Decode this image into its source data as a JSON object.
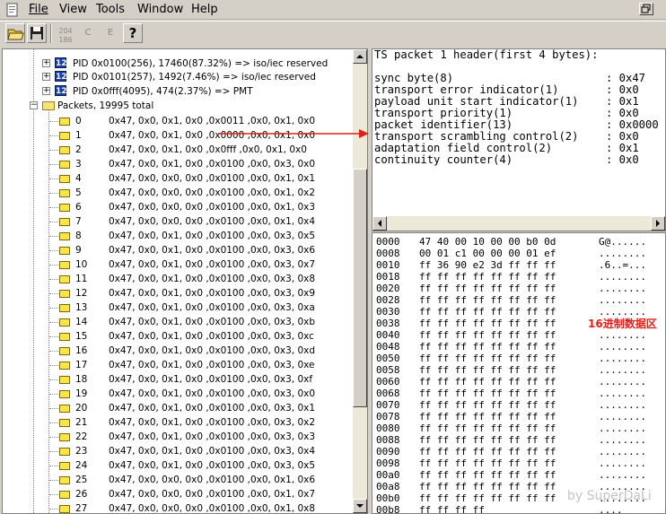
{
  "menu": {
    "items": [
      "File",
      "View",
      "Tools",
      "Window",
      "Help"
    ]
  },
  "toolbar": {
    "buttons": [
      {
        "name": "open-folder-icon"
      },
      {
        "name": "save-icon"
      },
      {
        "name": "hex-toggle",
        "label": "204\n186"
      },
      {
        "name": "c-button",
        "label": "C"
      },
      {
        "name": "e-button",
        "label": "E"
      },
      {
        "name": "help-icon",
        "label": "?"
      }
    ]
  },
  "tree": {
    "pids": [
      {
        "icon": "12",
        "text": "PID 0x0100(256), 17460(87.32%) => iso/iec reserved"
      },
      {
        "icon": "12",
        "text": "PID 0x0101(257), 1492(7.46%) => iso/iec reserved"
      },
      {
        "icon": "12",
        "text": "PID 0x0fff(4095), 474(2.37%) => PMT"
      }
    ],
    "packets_label": "Packets, 19995 total",
    "packets": [
      {
        "n": "0",
        "d": "0x47, 0x0, 0x1, 0x0 ,0x0011 ,0x0, 0x1, 0x0"
      },
      {
        "n": "1",
        "d": "0x47, 0x0, 0x1, 0x0 ,0x0000 ,0x0, 0x1, 0x0"
      },
      {
        "n": "2",
        "d": "0x47, 0x0, 0x1, 0x0 ,0x0fff ,0x0, 0x1, 0x0"
      },
      {
        "n": "3",
        "d": "0x47, 0x0, 0x1, 0x0 ,0x0100 ,0x0, 0x3, 0x0"
      },
      {
        "n": "4",
        "d": "0x47, 0x0, 0x0, 0x0 ,0x0100 ,0x0, 0x1, 0x1"
      },
      {
        "n": "5",
        "d": "0x47, 0x0, 0x0, 0x0 ,0x0100 ,0x0, 0x1, 0x2"
      },
      {
        "n": "6",
        "d": "0x47, 0x0, 0x0, 0x0 ,0x0100 ,0x0, 0x1, 0x3"
      },
      {
        "n": "7",
        "d": "0x47, 0x0, 0x0, 0x0 ,0x0100 ,0x0, 0x1, 0x4"
      },
      {
        "n": "8",
        "d": "0x47, 0x0, 0x1, 0x0 ,0x0100 ,0x0, 0x3, 0x5"
      },
      {
        "n": "9",
        "d": "0x47, 0x0, 0x1, 0x0 ,0x0100 ,0x0, 0x3, 0x6"
      },
      {
        "n": "10",
        "d": "0x47, 0x0, 0x1, 0x0 ,0x0100 ,0x0, 0x3, 0x7"
      },
      {
        "n": "11",
        "d": "0x47, 0x0, 0x1, 0x0 ,0x0100 ,0x0, 0x3, 0x8"
      },
      {
        "n": "12",
        "d": "0x47, 0x0, 0x1, 0x0 ,0x0100 ,0x0, 0x3, 0x9"
      },
      {
        "n": "13",
        "d": "0x47, 0x0, 0x1, 0x0 ,0x0100 ,0x0, 0x3, 0xa"
      },
      {
        "n": "14",
        "d": "0x47, 0x0, 0x1, 0x0 ,0x0100 ,0x0, 0x3, 0xb"
      },
      {
        "n": "15",
        "d": "0x47, 0x0, 0x1, 0x0 ,0x0100 ,0x0, 0x3, 0xc"
      },
      {
        "n": "16",
        "d": "0x47, 0x0, 0x1, 0x0 ,0x0100 ,0x0, 0x3, 0xd"
      },
      {
        "n": "17",
        "d": "0x47, 0x0, 0x1, 0x0 ,0x0100 ,0x0, 0x3, 0xe"
      },
      {
        "n": "18",
        "d": "0x47, 0x0, 0x1, 0x0 ,0x0100 ,0x0, 0x3, 0xf"
      },
      {
        "n": "19",
        "d": "0x47, 0x0, 0x1, 0x0 ,0x0100 ,0x0, 0x3, 0x0"
      },
      {
        "n": "20",
        "d": "0x47, 0x0, 0x1, 0x0 ,0x0100 ,0x0, 0x3, 0x1"
      },
      {
        "n": "21",
        "d": "0x47, 0x0, 0x1, 0x0 ,0x0100 ,0x0, 0x3, 0x2"
      },
      {
        "n": "22",
        "d": "0x47, 0x0, 0x1, 0x0 ,0x0100 ,0x0, 0x3, 0x3"
      },
      {
        "n": "23",
        "d": "0x47, 0x0, 0x1, 0x0 ,0x0100 ,0x0, 0x3, 0x4"
      },
      {
        "n": "24",
        "d": "0x47, 0x0, 0x1, 0x0 ,0x0100 ,0x0, 0x3, 0x5"
      },
      {
        "n": "25",
        "d": "0x47, 0x0, 0x0, 0x0 ,0x0100 ,0x0, 0x1, 0x6"
      },
      {
        "n": "26",
        "d": "0x47, 0x0, 0x0, 0x0 ,0x0100 ,0x0, 0x1, 0x7"
      },
      {
        "n": "27",
        "d": "0x47, 0x0, 0x0, 0x0 ,0x0100 ,0x0, 0x1, 0x8"
      }
    ]
  },
  "header": {
    "title": "TS packet 1 header(first 4 bytes):",
    "fields": [
      {
        "name": "sync byte(8)",
        "value": ": 0x47"
      },
      {
        "name": "transport error indicator(1)",
        "value": ": 0x0"
      },
      {
        "name": "payload unit start indicator(1)",
        "value": ": 0x1"
      },
      {
        "name": "transport priority(1)",
        "value": ": 0x0"
      },
      {
        "name": "packet identifier(13)",
        "value": ": 0x0000"
      },
      {
        "name": "transport scrambling control(2)",
        "value": ": 0x0"
      },
      {
        "name": "adaptation field control(2)",
        "value": ": 0x1"
      },
      {
        "name": "continuity counter(4)",
        "value": ": 0x0"
      }
    ]
  },
  "hex": {
    "rows": [
      {
        "off": "0000",
        "bytes": "47 40 00 10 00 00 b0 0d",
        "asc": "G@......"
      },
      {
        "off": "0008",
        "bytes": "00 01 c1 00 00 00 01 ef",
        "asc": "........"
      },
      {
        "off": "0010",
        "bytes": "ff 36 90 e2 3d ff ff ff",
        "asc": ".6..=..."
      },
      {
        "off": "0018",
        "bytes": "ff ff ff ff ff ff ff ff",
        "asc": "........"
      },
      {
        "off": "0020",
        "bytes": "ff ff ff ff ff ff ff ff",
        "asc": "........"
      },
      {
        "off": "0028",
        "bytes": "ff ff ff ff ff ff ff ff",
        "asc": "........"
      },
      {
        "off": "0030",
        "bytes": "ff ff ff ff ff ff ff ff",
        "asc": "........"
      },
      {
        "off": "0038",
        "bytes": "ff ff ff ff ff ff ff ff",
        "asc": ""
      },
      {
        "off": "0040",
        "bytes": "ff ff ff ff ff ff ff ff",
        "asc": "........"
      },
      {
        "off": "0048",
        "bytes": "ff ff ff ff ff ff ff ff",
        "asc": "........"
      },
      {
        "off": "0050",
        "bytes": "ff ff ff ff ff ff ff ff",
        "asc": "........"
      },
      {
        "off": "0058",
        "bytes": "ff ff ff ff ff ff ff ff",
        "asc": "........"
      },
      {
        "off": "0060",
        "bytes": "ff ff ff ff ff ff ff ff",
        "asc": "........"
      },
      {
        "off": "0068",
        "bytes": "ff ff ff ff ff ff ff ff",
        "asc": "........"
      },
      {
        "off": "0070",
        "bytes": "ff ff ff ff ff ff ff ff",
        "asc": "........"
      },
      {
        "off": "0078",
        "bytes": "ff ff ff ff ff ff ff ff",
        "asc": "........"
      },
      {
        "off": "0080",
        "bytes": "ff ff ff ff ff ff ff ff",
        "asc": "........"
      },
      {
        "off": "0088",
        "bytes": "ff ff ff ff ff ff ff ff",
        "asc": "........"
      },
      {
        "off": "0090",
        "bytes": "ff ff ff ff ff ff ff ff",
        "asc": "........"
      },
      {
        "off": "0098",
        "bytes": "ff ff ff ff ff ff ff ff",
        "asc": "........"
      },
      {
        "off": "00a0",
        "bytes": "ff ff ff ff ff ff ff ff",
        "asc": "........"
      },
      {
        "off": "00a8",
        "bytes": "ff ff ff ff ff ff ff ff",
        "asc": "........"
      },
      {
        "off": "00b0",
        "bytes": "ff ff ff ff ff ff ff ff",
        "asc": "........"
      },
      {
        "off": "00b8",
        "bytes": "ff ff ff ff",
        "asc": "...."
      }
    ],
    "annotation": "16进制数据区"
  },
  "watermark": "by SuperDaLi",
  "colors": {
    "annotation": "#e0201a",
    "arrow": "#e0201a",
    "packet_icon": "#ffe44c",
    "pid_icon": "#1b3f9e"
  }
}
